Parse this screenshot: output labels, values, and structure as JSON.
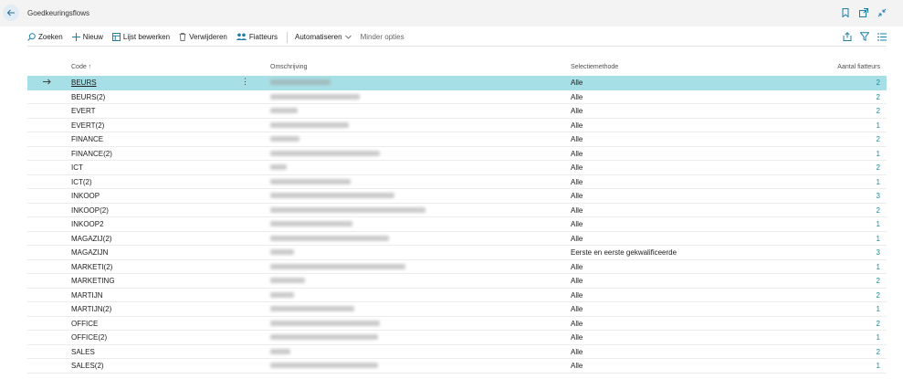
{
  "page": {
    "title": "Goedkeuringsflows"
  },
  "toolbar": {
    "search": "Zoeken",
    "new": "Nieuw",
    "edit_list": "Lijst bewerken",
    "delete": "Verwijderen",
    "approvers": "Fiatteurs",
    "automate": "Automatiseren",
    "fewer_options": "Minder opties"
  },
  "table": {
    "headers": {
      "code": "Code ↑",
      "description": "Omschrijving",
      "selection_method": "Selectiemethode",
      "approver_count": "Aantal fiatteurs"
    },
    "rows": [
      {
        "code": "BEURS",
        "selection": "Alle",
        "count": "2",
        "selected": true
      },
      {
        "code": "BEURS(2)",
        "selection": "Alle",
        "count": "2"
      },
      {
        "code": "EVERT",
        "selection": "Alle",
        "count": "2"
      },
      {
        "code": "EVERT(2)",
        "selection": "Alle",
        "count": "1"
      },
      {
        "code": "FINANCE",
        "selection": "Alle",
        "count": "2"
      },
      {
        "code": "FINANCE(2)",
        "selection": "Alle",
        "count": "1"
      },
      {
        "code": "ICT",
        "selection": "Alle",
        "count": "2"
      },
      {
        "code": "ICT(2)",
        "selection": "Alle",
        "count": "1"
      },
      {
        "code": "INKOOP",
        "selection": "Alle",
        "count": "3"
      },
      {
        "code": "INKOOP(2)",
        "selection": "Alle",
        "count": "2"
      },
      {
        "code": "INKOOP2",
        "selection": "Alle",
        "count": "1"
      },
      {
        "code": "MAGAZIJ(2)",
        "selection": "Alle",
        "count": "1"
      },
      {
        "code": "MAGAZIJN",
        "selection": "Eerste en eerste gekwalificeerde",
        "count": "3"
      },
      {
        "code": "MARKETI(2)",
        "selection": "Alle",
        "count": "1"
      },
      {
        "code": "MARKETING",
        "selection": "Alle",
        "count": "2"
      },
      {
        "code": "MARTIJN",
        "selection": "Alle",
        "count": "2"
      },
      {
        "code": "MARTIJN(2)",
        "selection": "Alle",
        "count": "1"
      },
      {
        "code": "OFFICE",
        "selection": "Alle",
        "count": "2"
      },
      {
        "code": "OFFICE(2)",
        "selection": "Alle",
        "count": "1"
      },
      {
        "code": "SALES",
        "selection": "Alle",
        "count": "2"
      },
      {
        "code": "SALES(2)",
        "selection": "Alle",
        "count": "1"
      }
    ]
  },
  "colors": {
    "accent": "#1f8a93",
    "selected_row": "#a6dfe5",
    "topbar": "#f3f3f3"
  },
  "icons": [
    "back-arrow-icon",
    "bookmark-icon",
    "open-new-window-icon",
    "collapse-icon",
    "search-icon",
    "plus-icon",
    "edit-list-icon",
    "trash-icon",
    "people-icon",
    "chevron-down-icon",
    "share-icon",
    "filter-icon",
    "list-view-icon",
    "row-arrow-icon",
    "more-options-icon"
  ]
}
